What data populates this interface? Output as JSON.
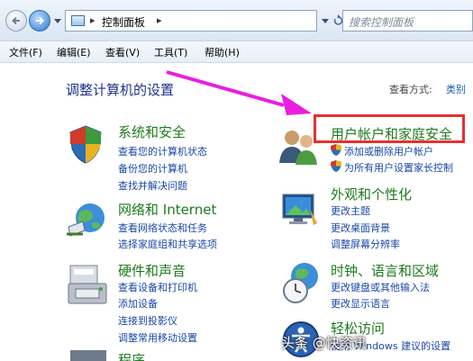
{
  "address_bar": {
    "path": "控制面板",
    "search_placeholder": "搜索控制面板"
  },
  "menu": [
    "文件(F)",
    "编辑(E)",
    "查看(V)",
    "工具(T)",
    "帮助(H)"
  ],
  "page": {
    "title": "调整计算机的设置",
    "view_by_label": "查看方式:",
    "view_by_value": "类别"
  },
  "categories": [
    {
      "title": "系统和安全",
      "links": [
        "查看您的计算机状态",
        "备份您的计算机",
        "查找并解决问题"
      ]
    },
    {
      "title": "网络和 Internet",
      "links": [
        "查看网络状态和任务",
        "选择家庭组和共享选项"
      ]
    },
    {
      "title": "硬件和声音",
      "links": [
        "查看设备和打印机",
        "添加设备",
        "连接到投影仪",
        "调整常用移动设置"
      ]
    },
    {
      "title": "程序",
      "links": []
    },
    {
      "title": "用户帐户和家庭安全",
      "links": [
        "添加或删除用户帐户",
        "为所有用户设置家长控制"
      ]
    },
    {
      "title": "外观和个性化",
      "links": [
        "更改主题",
        "更改桌面背景",
        "调整屏幕分辨率"
      ]
    },
    {
      "title": "时钟、语言和区域",
      "links": [
        "更改键盘或其他输入法",
        "更改显示语言"
      ]
    },
    {
      "title": "轻松访问",
      "links": [
        "使用 Windows 建议的设置"
      ]
    }
  ],
  "watermark": "头条 @快资讯",
  "colors": {
    "title_blue": "#1e3287",
    "category_green": "#1e7a1e",
    "link_blue": "#1a47a8",
    "annotation_red": "#e53130",
    "annotation_magenta": "#e91ee0"
  },
  "icons": [
    "back-arrow-icon",
    "forward-arrow-icon",
    "control-panel-icon",
    "refresh-icon",
    "search-icon",
    "system-security-icon",
    "network-icon",
    "hardware-printer-icon",
    "user-accounts-icon",
    "shield-icon",
    "appearance-icon",
    "clock-globe-icon",
    "ease-of-access-icon"
  ]
}
